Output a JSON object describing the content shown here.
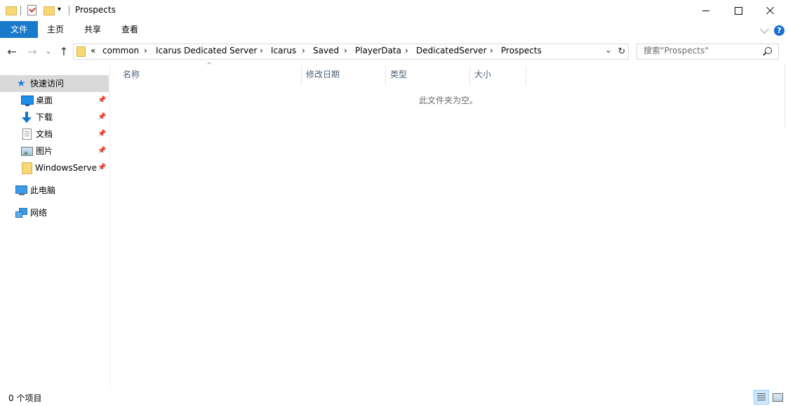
{
  "window": {
    "title": "Prospects"
  },
  "ribbon": {
    "tabs": [
      "文件",
      "主页",
      "共享",
      "查看"
    ],
    "help_label": "?"
  },
  "navigation": {
    "overflow_label": "«",
    "breadcrumbs": [
      "common",
      "Icarus Dedicated Server",
      "Icarus",
      "Saved",
      "PlayerData",
      "DedicatedServer",
      "Prospects"
    ],
    "separator": "›",
    "search_placeholder": "搜索\"Prospects\""
  },
  "sidebar": {
    "quick_access": "快速访问",
    "items": [
      {
        "label": "桌面",
        "icon": "desktop-icon",
        "pinned": true
      },
      {
        "label": "下载",
        "icon": "download-icon",
        "pinned": true
      },
      {
        "label": "文档",
        "icon": "documents-icon",
        "pinned": true
      },
      {
        "label": "图片",
        "icon": "pictures-icon",
        "pinned": true
      },
      {
        "label": "WindowsServer",
        "icon": "folder-icon",
        "pinned": true
      }
    ],
    "this_pc": "此电脑",
    "network": "网络"
  },
  "content": {
    "columns": [
      "名称",
      "修改日期",
      "类型",
      "大小"
    ],
    "empty_message": "此文件夹为空。"
  },
  "status": {
    "item_count": "0 个项目"
  },
  "colors": {
    "accent": "#1979ca",
    "selected_bg": "#d9d9d9",
    "column_header_text": "#4c607a"
  }
}
